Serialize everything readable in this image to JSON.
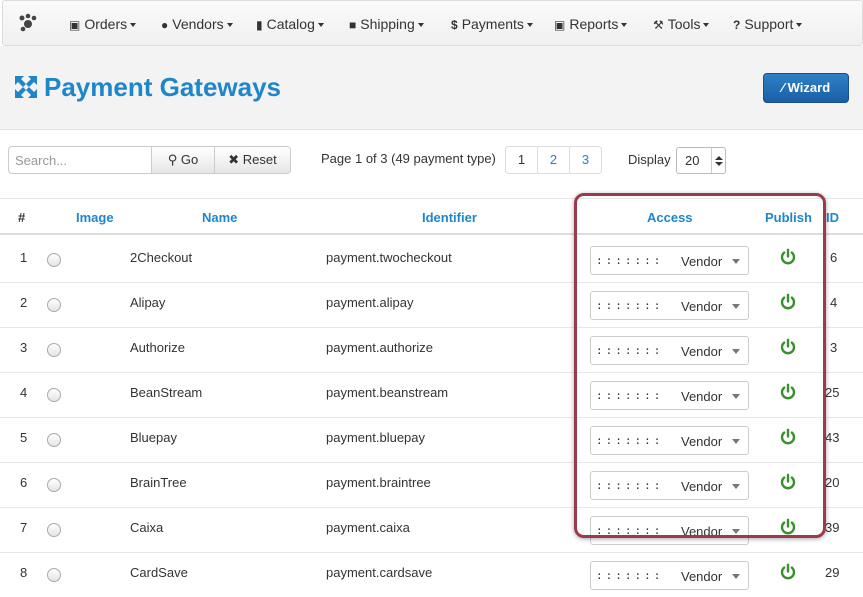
{
  "nav": {
    "items": [
      {
        "id": "orders",
        "label": "Orders",
        "icon": "monitor-icon"
      },
      {
        "id": "vendors",
        "label": "Vendors",
        "icon": "user-icon"
      },
      {
        "id": "catalog",
        "label": "Catalog",
        "icon": "bookmark-icon"
      },
      {
        "id": "shipping",
        "label": "Shipping",
        "icon": "truck-icon"
      },
      {
        "id": "payments",
        "label": "Payments",
        "icon": "dollar-icon"
      },
      {
        "id": "reports",
        "label": "Reports",
        "icon": "monitor-icon"
      },
      {
        "id": "tools",
        "label": "Tools",
        "icon": "wrench-icon"
      },
      {
        "id": "support",
        "label": "Support",
        "icon": "question-icon"
      }
    ]
  },
  "page": {
    "title": "Payment Gateways",
    "wizard_label": "Wizard"
  },
  "toolbar": {
    "search_placeholder": "Search...",
    "go_label": "Go",
    "reset_label": "Reset",
    "page_info": "Page 1 of 3 (49 payment type)",
    "pages": [
      "1",
      "2",
      "3"
    ],
    "display_label": "Display",
    "display_value": "20"
  },
  "table": {
    "headers": {
      "num": "#",
      "image": "Image",
      "name": "Name",
      "identifier": "Identifier",
      "access": "Access",
      "publish": "Publish",
      "id": "ID"
    },
    "access_dots": ":::::::",
    "rows": [
      {
        "num": "1",
        "name": "2Checkout",
        "identifier": "payment.twocheckout",
        "access": "Vendor",
        "id": "6"
      },
      {
        "num": "2",
        "name": "Alipay",
        "identifier": "payment.alipay",
        "access": "Vendor",
        "id": "4"
      },
      {
        "num": "3",
        "name": "Authorize",
        "identifier": "payment.authorize",
        "access": "Vendor",
        "id": "3"
      },
      {
        "num": "4",
        "name": "BeanStream",
        "identifier": "payment.beanstream",
        "access": "Vendor",
        "id": "25"
      },
      {
        "num": "5",
        "name": "Bluepay",
        "identifier": "payment.bluepay",
        "access": "Vendor",
        "id": "43"
      },
      {
        "num": "6",
        "name": "BrainTree",
        "identifier": "payment.braintree",
        "access": "Vendor",
        "id": "20"
      },
      {
        "num": "7",
        "name": "Caixa",
        "identifier": "payment.caixa",
        "access": "Vendor",
        "id": "39"
      },
      {
        "num": "8",
        "name": "CardSave",
        "identifier": "payment.cardsave",
        "access": "Vendor",
        "id": "29"
      }
    ]
  },
  "colors": {
    "accent": "#1f86c9",
    "publish_green": "#3a8f2e",
    "highlight": "#9b3a4a"
  }
}
